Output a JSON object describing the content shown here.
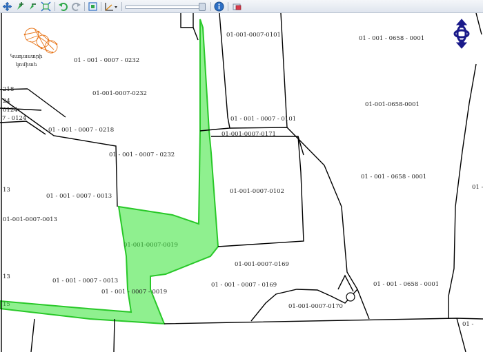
{
  "toolbar": {
    "tools": [
      {
        "name": "pan",
        "icon": "pan-arrows-icon"
      },
      {
        "name": "zoom-in",
        "icon": "zoom-in-icon"
      },
      {
        "name": "zoom-out",
        "icon": "zoom-out-icon"
      },
      {
        "name": "full-extent",
        "icon": "full-extent-icon"
      },
      {
        "name": "back",
        "icon": "back-arrow-icon"
      },
      {
        "name": "forward",
        "icon": "forward-arrow-icon"
      },
      {
        "name": "zoom-window",
        "icon": "zoom-window-icon"
      },
      {
        "name": "measure",
        "icon": "measure-ruler-icon"
      },
      {
        "name": "info",
        "icon": "info-icon"
      },
      {
        "name": "clear",
        "icon": "eraser-icon"
      }
    ],
    "zoom_level": 1.0
  },
  "logo": {
    "line1": "Կադաստրի",
    "line2": "կոմիտե"
  },
  "colors": {
    "highlight_fill": "#8ff08f",
    "highlight_stroke": "#28c828",
    "parcel_line": "#000000",
    "navigator": "#1a1a8a",
    "logo": "#e8781e"
  },
  "map": {
    "labels": [
      "01 - 001 - 0007 - 0232",
      "01-001-0007-0232",
      "01 - 001 - 0007 - 0218",
      "01 - 001 - 0007 - 0232",
      "01 - 001 - 0007 - 0013",
      "01-001-0007-0013",
      "01 - 001 - 0007 - 0013",
      "01-001-0007-0019",
      "01 - 001 - 0007 - 0019",
      "01-001-0007-0101",
      "01 - 001 - 0007 - 0101",
      "01-001-0007-0171",
      "01-001-0007-0102",
      "01-001-0007-0169",
      "01 - 001 - 0007 - 0169",
      "01-001-0007-0170",
      "01 - 001 - 0658 - 0001",
      "01-001-0658-0001",
      "01 - 001 - 0658 - 0001",
      "01 - 001 - 0658 - 0001",
      "218",
      "24",
      "0124",
      "7 - 0124",
      "13",
      "13",
      "15",
      "01 -",
      "01 -"
    ]
  }
}
